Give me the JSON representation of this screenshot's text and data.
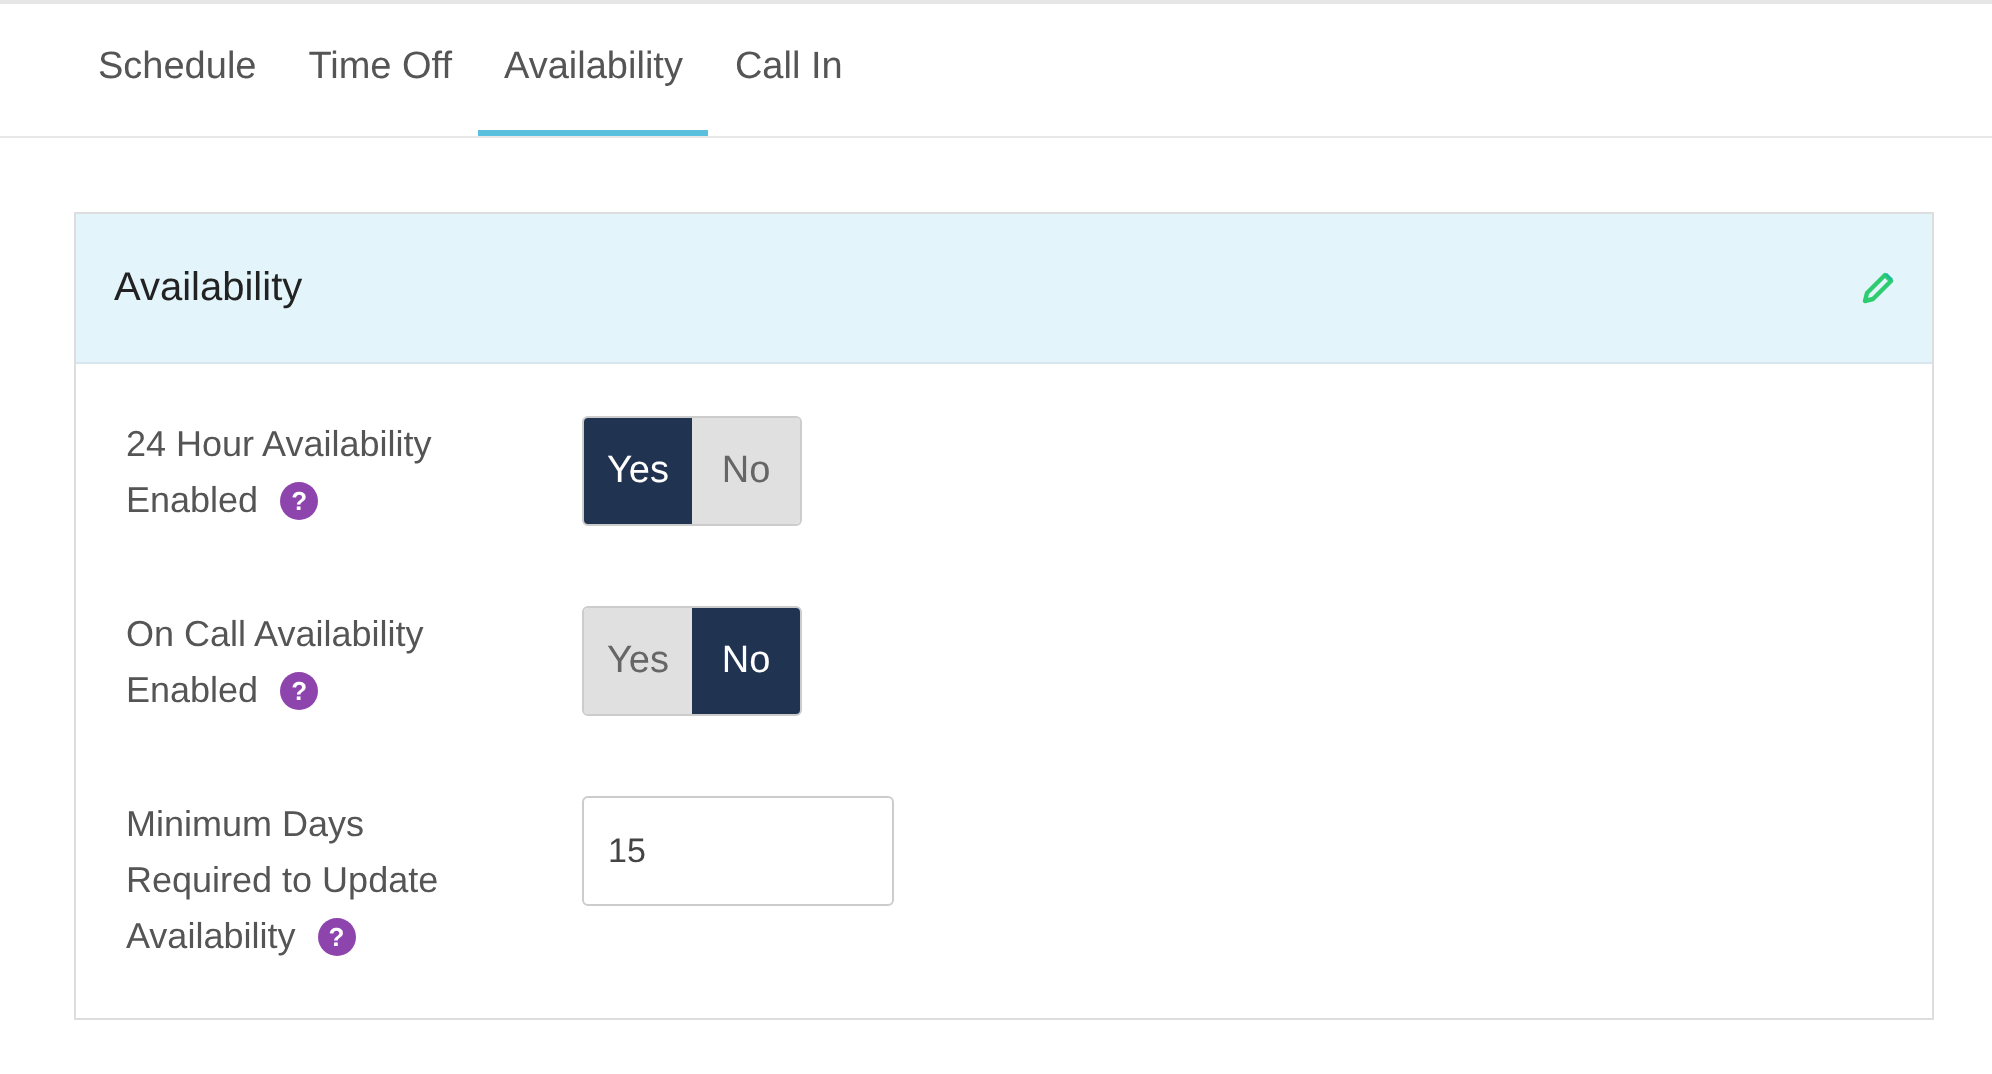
{
  "tabs": [
    {
      "label": "Schedule",
      "selected": false
    },
    {
      "label": "Time Off",
      "selected": false
    },
    {
      "label": "Availability",
      "selected": true
    },
    {
      "label": "Call In",
      "selected": false
    }
  ],
  "panel": {
    "title": "Availability",
    "rows": [
      {
        "kind": "toggle",
        "label": "24 Hour Availability Enabled",
        "help": "?",
        "options": [
          {
            "label": "Yes",
            "selected": true
          },
          {
            "label": "No",
            "selected": false
          }
        ]
      },
      {
        "kind": "toggle",
        "label": "On Call Availability Enabled",
        "help": "?",
        "options": [
          {
            "label": "Yes",
            "selected": false
          },
          {
            "label": "No",
            "selected": true
          }
        ]
      },
      {
        "kind": "input",
        "label": "Minimum Days Required to Update Availability",
        "help": "?",
        "value": "15"
      }
    ]
  }
}
